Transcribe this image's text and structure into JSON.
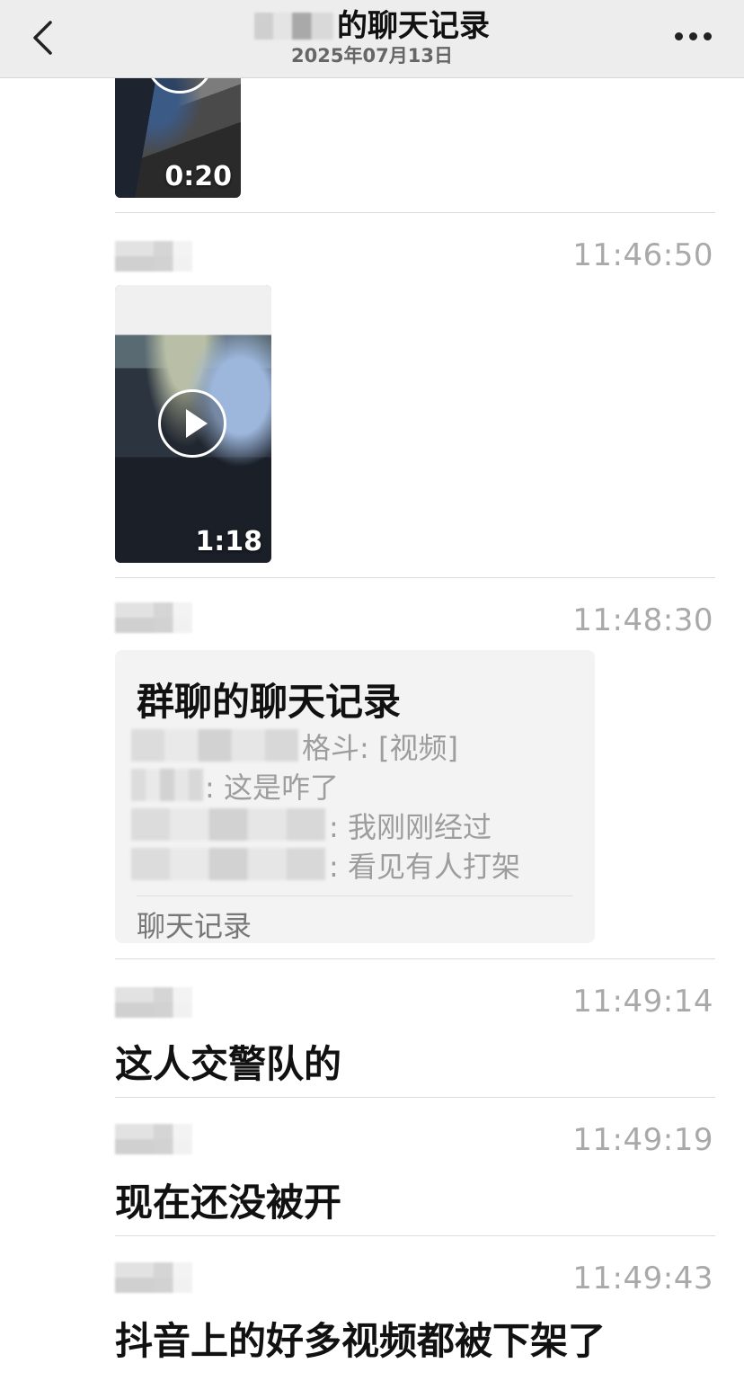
{
  "header": {
    "title": "的聊天记录",
    "date": "2025年07月13日"
  },
  "messages": [
    {
      "type": "video",
      "duration": "0:20"
    },
    {
      "type": "video",
      "time": "11:46:50",
      "duration": "1:18"
    },
    {
      "type": "chat_record",
      "time": "11:48:30",
      "record": {
        "title": "群聊的聊天记录",
        "lines": [
          "格斗: [视频]",
          ": 这是咋了",
          ": 我刚刚经过",
          ": 看见有人打架"
        ],
        "footer": "聊天记录"
      }
    },
    {
      "type": "text",
      "time": "11:49:14",
      "text": "这人交警队的"
    },
    {
      "type": "text",
      "time": "11:49:19",
      "text": "现在还没被开"
    },
    {
      "type": "text",
      "time": "11:49:43",
      "text": "抖音上的好多视频都被下架了"
    }
  ]
}
